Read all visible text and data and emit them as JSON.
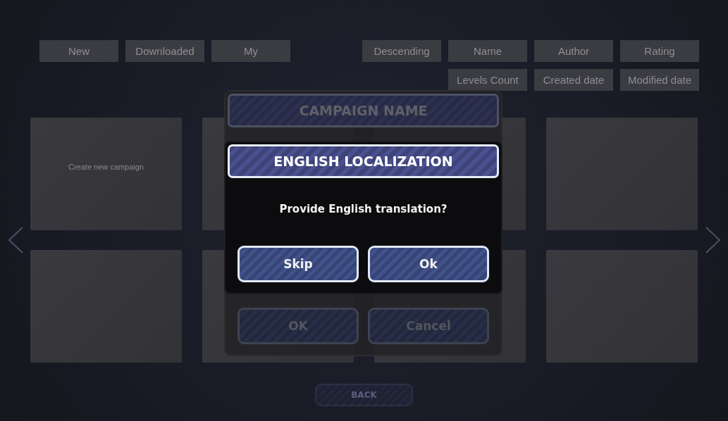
{
  "filters": [
    {
      "label": "New"
    },
    {
      "label": "Downloaded"
    },
    {
      "label": "My"
    }
  ],
  "sort_top": [
    {
      "label": "Descending"
    },
    {
      "label": "Name"
    },
    {
      "label": "Author"
    },
    {
      "label": "Rating"
    }
  ],
  "sort_bottom": [
    {
      "label": "Levels Count"
    },
    {
      "label": "Created date"
    },
    {
      "label": "Modified date"
    }
  ],
  "cards": [
    {
      "kind": "create",
      "label": "Create new campaign"
    },
    {
      "kind": "empty"
    },
    {
      "kind": "empty"
    },
    {
      "kind": "empty"
    },
    {
      "kind": "empty"
    },
    {
      "kind": "empty"
    },
    {
      "kind": "empty"
    },
    {
      "kind": "empty"
    }
  ],
  "back_button": {
    "label": "BACK"
  },
  "campaign_dialog": {
    "title": "CAMPAIGN NAME",
    "buttons": [
      {
        "label": "OK"
      },
      {
        "label": "Cancel"
      }
    ]
  },
  "localization_dialog": {
    "title": "ENGLISH LOCALIZATION",
    "message": "Provide English translation?",
    "buttons": [
      {
        "label": "Skip"
      },
      {
        "label": "Ok"
      }
    ]
  }
}
